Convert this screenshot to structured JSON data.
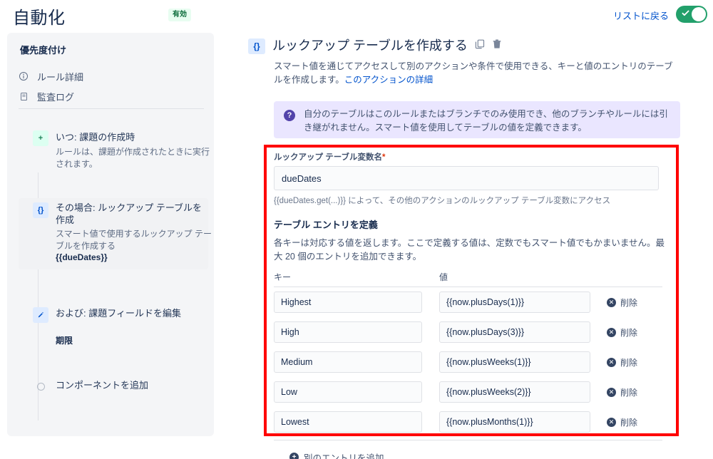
{
  "header": {
    "title": "自動化",
    "status_badge": "有効",
    "back_link": "リストに戻る",
    "toggle_on": true,
    "toggle_color": "#22a06b"
  },
  "sidebar": {
    "title": "優先度付け",
    "nav_items": [
      {
        "label": "ルール詳細",
        "icon": "info-circle-icon"
      },
      {
        "label": "監査ログ",
        "icon": "document-icon"
      }
    ],
    "steps": [
      {
        "icon": "plus-icon",
        "icon_glyph": "+",
        "title": "いつ: 課題の作成時",
        "desc": "ルールは、課題が作成されたときに実行されます。",
        "value": "",
        "active": false
      },
      {
        "icon": "braces-icon",
        "icon_glyph": "{}",
        "title": "その場合: ルックアップ テーブルを作成",
        "desc": "スマート値で使用するルックアップ テーブルを作成する",
        "value": "{{dueDates}}",
        "active": true
      },
      {
        "icon": "pencil-icon",
        "icon_glyph": "✎",
        "title": "および: 課題フィールドを編集",
        "desc": "",
        "value": "期限",
        "active": false
      },
      {
        "icon": "circle-outline-icon",
        "icon_glyph": "",
        "title": "コンポーネントを追加",
        "desc": "",
        "value": "",
        "active": false
      }
    ]
  },
  "main": {
    "action_icon_glyph": "{}",
    "action_title": "ルックアップ テーブルを作成する",
    "copy_icon": "copy-icon",
    "delete_icon": "trash-icon",
    "action_desc": "スマート値を通じてアクセスして別のアクションや条件で使用できる、キーと値のエントリのテーブルを作成します。",
    "action_desc_link": "このアクションの詳細",
    "info_icon_glyph": "?",
    "info_text": "自分のテーブルはこのルールまたはブランチでのみ使用でき、他のブランチやルールには引き継がれません。スマート値を使用してテーブルの値を定義できます。",
    "variable_label": "ルックアップ テーブル変数名",
    "variable_required_mark": "*",
    "variable_value": "dueDates",
    "variable_placeholder": "",
    "variable_help": "{{dueDates.get(...)}} によって、その他のアクションのルックアップ テーブル変数にアクセス",
    "entries_section_title": "テーブル エントリを定義",
    "entries_section_desc": "各キーは対応する値を返します。ここで定義する値は、定数でもスマート値でもかまいません。最大 20 個のエントリを追加できます。",
    "table": {
      "col_key": "キー",
      "col_value": "値",
      "delete_label": "削除",
      "rows": [
        {
          "key": "Highest",
          "value": "{{now.plusDays(1)}}"
        },
        {
          "key": "High",
          "value": "{{now.plusDays(3)}}"
        },
        {
          "key": "Medium",
          "value": "{{now.plusWeeks(1)}}"
        },
        {
          "key": "Low",
          "value": "{{now.plusWeeks(2)}}"
        },
        {
          "key": "Lowest",
          "value": "{{now.plusMonths(1)}}"
        }
      ]
    },
    "add_entry_label": "別のエントリを追加",
    "add_entry_glyph": "+"
  },
  "annotation": {
    "color": "#ff0000"
  }
}
